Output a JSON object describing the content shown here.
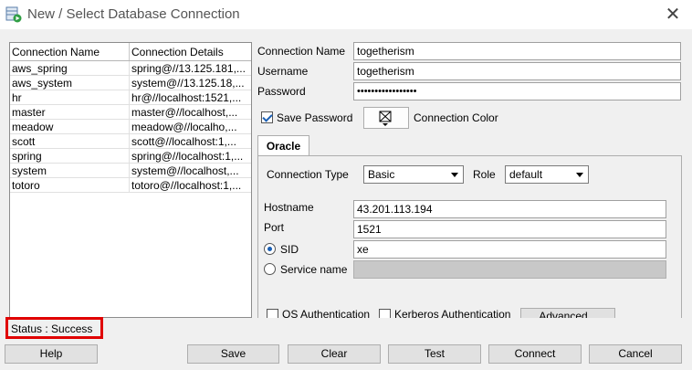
{
  "window": {
    "title": "New / Select Database Connection",
    "close_glyph": "✕"
  },
  "connections": {
    "headers": {
      "name": "Connection Name",
      "details": "Connection Details"
    },
    "rows": [
      {
        "name": "aws_spring",
        "details": "spring@//13.125.181,..."
      },
      {
        "name": "aws_system",
        "details": "system@//13.125.18,..."
      },
      {
        "name": "hr",
        "details": "hr@//localhost:1521,..."
      },
      {
        "name": "master",
        "details": "master@//localhost,..."
      },
      {
        "name": "meadow",
        "details": "meadow@//localho,..."
      },
      {
        "name": "scott",
        "details": "scott@//localhost:1,..."
      },
      {
        "name": "spring",
        "details": "spring@//localhost:1,..."
      },
      {
        "name": "system",
        "details": "system@//localhost,..."
      },
      {
        "name": "totoro",
        "details": "totoro@//localhost:1,..."
      }
    ]
  },
  "form": {
    "connection_name_label": "Connection Name",
    "connection_name_value": "togetherism",
    "username_label": "Username",
    "username_value": "togetherism",
    "password_label": "Password",
    "password_value": "•••••••••••••••••",
    "save_password_label": "Save Password",
    "save_password_checked": true,
    "connection_color_label": "Connection Color"
  },
  "oracle_tab": {
    "tab_label": "Oracle",
    "connection_type_label": "Connection Type",
    "connection_type_value": "Basic",
    "role_label": "Role",
    "role_value": "default",
    "hostname_label": "Hostname",
    "hostname_value": "43.201.113.194",
    "port_label": "Port",
    "port_value": "1521",
    "sid_label": "SID",
    "sid_value": "xe",
    "service_name_label": "Service name",
    "service_name_value": "",
    "os_auth_label": "OS Authentication",
    "kerberos_auth_label": "Kerberos Authentication",
    "advanced_label": "Advanced..."
  },
  "status": {
    "text": "Status : Success"
  },
  "buttons": {
    "help": "Help",
    "save": "Save",
    "clear": "Clear",
    "test": "Test",
    "connect": "Connect",
    "cancel": "Cancel"
  },
  "colors": {
    "status_highlight": "#e00000",
    "accent": "#1a5fb4",
    "window_bg": "#f0f0f0"
  }
}
